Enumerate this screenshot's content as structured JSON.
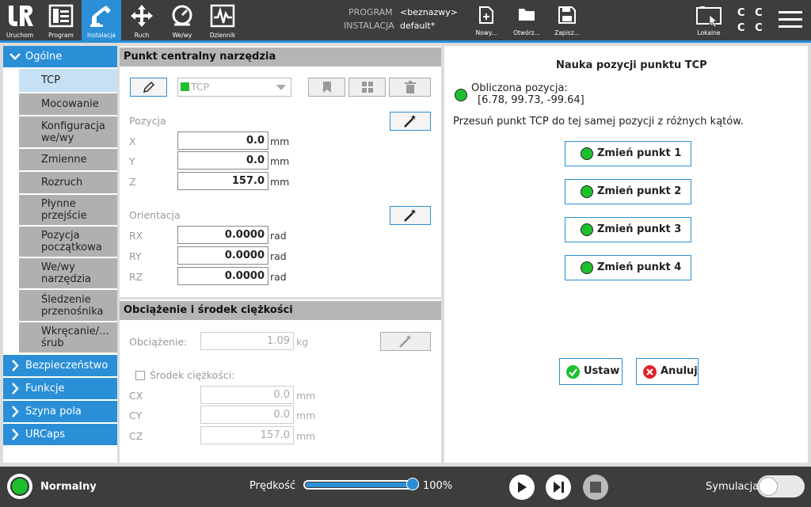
{
  "topbar": {
    "nav": [
      {
        "label": "Uruchom",
        "icon": "ur-logo-icon"
      },
      {
        "label": "Program",
        "icon": "program-icon"
      },
      {
        "label": "Instalacja",
        "icon": "installation-icon",
        "active": true
      },
      {
        "label": "Ruch",
        "icon": "move-icon"
      },
      {
        "label": "We/wy",
        "icon": "io-icon"
      },
      {
        "label": "Dziennik",
        "icon": "log-icon"
      }
    ],
    "program_label": "PROGRAM",
    "program_value": "<beznazwy>",
    "installation_label": "INSTALACJA",
    "installation_value": "default*",
    "file_buttons": [
      {
        "label": "Nowy...",
        "icon": "new-file-icon"
      },
      {
        "label": "Otwórz...",
        "icon": "folder-icon"
      },
      {
        "label": "Zapisz...",
        "icon": "save-icon"
      }
    ],
    "local_label": "Lokalne",
    "cc_top": "C C",
    "cc_bottom": "C C"
  },
  "sidebar": {
    "general": "Ogólne",
    "sub_items": [
      "TCP",
      "Mocowanie",
      "Konfiguracja we/wy",
      "Zmienne",
      "Rozruch",
      "Płynne przejście",
      "Pozycja początkowa",
      "We/wy narzędzia",
      "Śledzenie przenośnika",
      "Wkręcanie/... śrub"
    ],
    "sections": [
      "Bezpieczeństwo",
      "Funkcje",
      "Szyna pola",
      "URCaps"
    ]
  },
  "tcp_panel": {
    "title": "Punkt centralny narzędzia",
    "dropdown_value": "TCP",
    "position_label": "Pozycja",
    "x_label": "X",
    "x_value": "0.0",
    "y_label": "Y",
    "y_value": "0.0",
    "z_label": "Z",
    "z_value": "157.0",
    "mm": "mm",
    "orientation_label": "Orientacja",
    "rx_label": "RX",
    "rx_value": "0.0000",
    "ry_label": "RY",
    "ry_value": "0.0000",
    "rz_label": "RZ",
    "rz_value": "0.0000",
    "rad": "rad"
  },
  "payload_panel": {
    "title": "Obciążenie i środek ciężkości",
    "payload_label": "Obciążenie:",
    "payload_value": "1.09",
    "kg": "kg",
    "cog_label": "Środek ciężkości:",
    "cx_label": "CX",
    "cx_value": "0.0",
    "cy_label": "CY",
    "cy_value": "0.0",
    "cz_label": "CZ",
    "cz_value": "157.0",
    "mm": "mm"
  },
  "teach_panel": {
    "title": "Nauka pozycji punktu TCP",
    "computed_label": "Obliczona pozycja:",
    "computed_value": "[6.78, 99.73, -99.64]",
    "instruction": "Przesuń punkt TCP do tej samej pozycji z różnych kątów.",
    "points": [
      "Zmień punkt 1",
      "Zmień punkt 2",
      "Zmień punkt 3",
      "Zmień punkt 4"
    ],
    "set_label": "Ustaw",
    "cancel_label": "Anuluj"
  },
  "bottombar": {
    "status": "Normalny",
    "speed_label": "Prędkość",
    "speed_value": "100%",
    "speed_fraction": 1.0,
    "simulation_label": "Symulacja"
  },
  "colors": {
    "accent": "#2a8fd6",
    "status_green": "#1dbf2e",
    "error_red": "#e0242c"
  }
}
